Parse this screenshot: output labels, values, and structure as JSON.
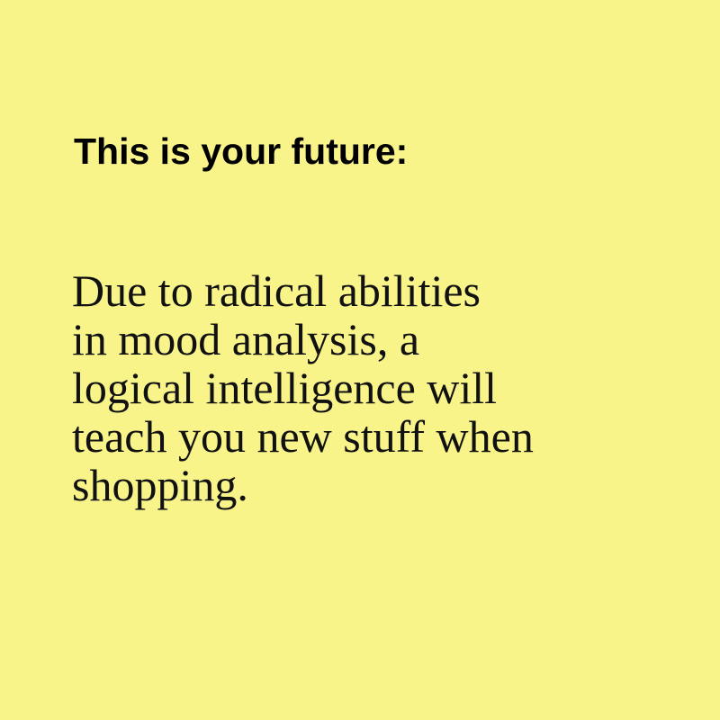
{
  "card": {
    "background_color": "#f9f48a",
    "heading": "This is your future:",
    "body_lines": [
      "Due to radical abilities",
      "in mood analysis, a",
      "logical intelligence will",
      "teach you new stuff when",
      "shopping."
    ]
  }
}
